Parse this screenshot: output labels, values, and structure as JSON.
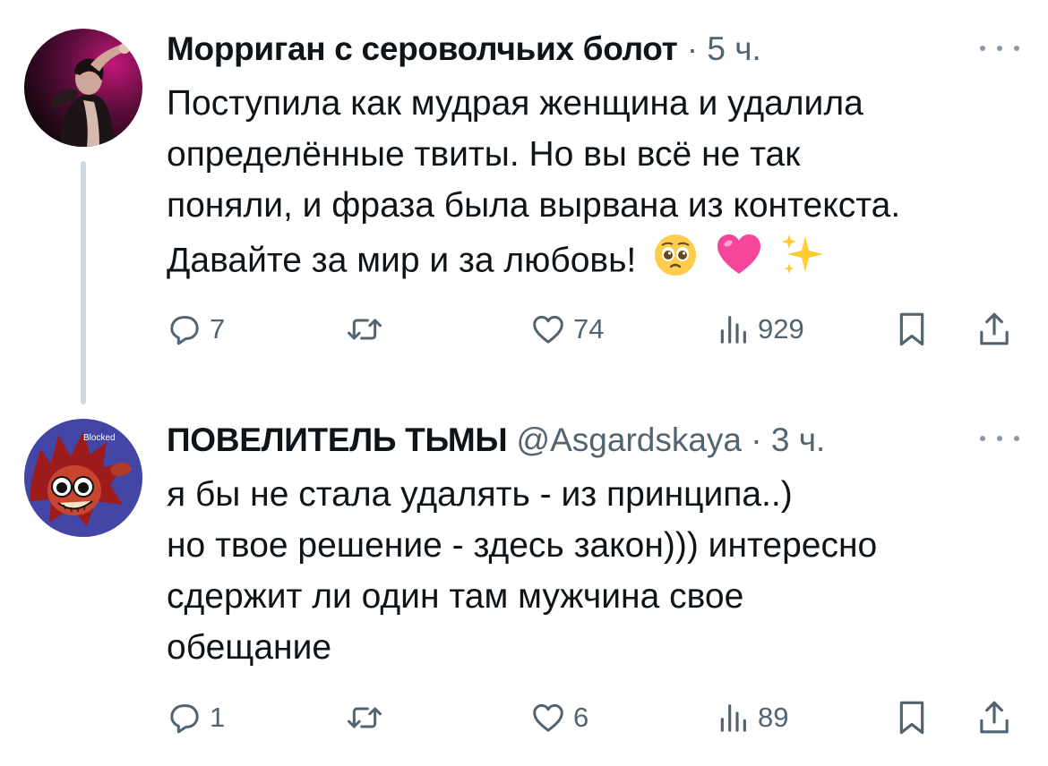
{
  "tweets": [
    {
      "author": "Морриган с сероволчьих болот",
      "handle": "",
      "dot": "·",
      "time": "5 ч.",
      "text_lines": [
        "Поступила как мудрая женщина и удалила",
        "определённые твиты. Но вы всё не так",
        "поняли, и фраза была вырвана из контекста.",
        "Давайте за мир и за любовь!"
      ],
      "emojis": [
        "pleading-face-icon",
        "pink-heart-icon",
        "sparkles-icon"
      ],
      "replies": "7",
      "retweets": "",
      "likes": "74",
      "views": "929"
    },
    {
      "author": "ПОВЕЛИТЕЛЬ ТЬМЫ",
      "handle": "@Asgardskaya",
      "dot": "·",
      "time": "3 ч.",
      "avatar_badge": "Blocked",
      "text_lines": [
        "я бы не стала удалять - из принципа..)",
        "но твое решение - здесь закон))) интересно",
        "сдержит ли один там мужчина свое",
        "обещание"
      ],
      "replies": "1",
      "retweets": "",
      "likes": "6",
      "views": "89"
    }
  ],
  "colors": {
    "text": "#0f1419",
    "secondary": "#536471",
    "thread_line": "#cfd9de"
  }
}
